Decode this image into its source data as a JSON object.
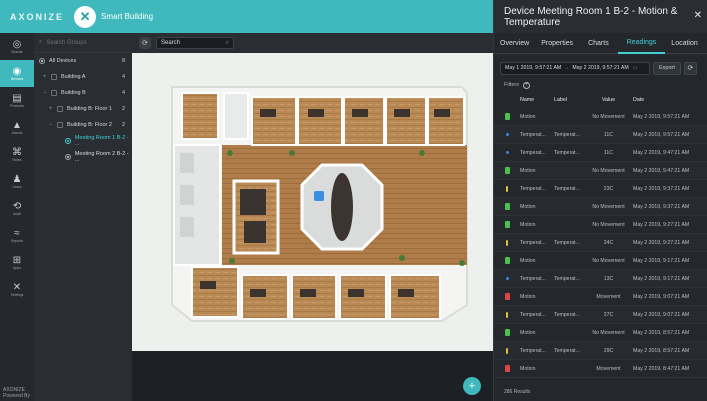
{
  "topbar": {
    "brand": "AXONIZE",
    "app_name": "Smart Building"
  },
  "nav": {
    "items": [
      {
        "label": "Boards",
        "icon": "boards-icon",
        "glyph": "◎"
      },
      {
        "label": "Devices",
        "icon": "devices-icon",
        "glyph": "◉"
      },
      {
        "label": "Products",
        "icon": "products-icon",
        "glyph": "▤"
      },
      {
        "label": "Alarms",
        "icon": "bell-icon",
        "glyph": "▲"
      },
      {
        "label": "Rules",
        "icon": "rules-icon",
        "glyph": "⌘"
      },
      {
        "label": "Users",
        "icon": "user-icon",
        "glyph": "♟"
      },
      {
        "label": "Audit",
        "icon": "history-icon",
        "glyph": "⟲"
      },
      {
        "label": "Reports",
        "icon": "reports-icon",
        "glyph": "≈"
      },
      {
        "label": "Apps",
        "icon": "apps-icon",
        "glyph": "⊞"
      },
      {
        "label": "Settings",
        "icon": "settings-icon",
        "glyph": "✕"
      }
    ],
    "footer_brand": "AXONIZE",
    "footer_powered": "Powered By"
  },
  "tree": {
    "search_placeholder": "Search Groups",
    "rows": [
      {
        "label": "All Devices",
        "count": "8"
      },
      {
        "label": "Building A",
        "count": "4"
      },
      {
        "label": "Building B",
        "count": "4"
      },
      {
        "label": "Building B: Floor 1",
        "count": "2"
      },
      {
        "label": "Building B: Floor 2",
        "count": "2"
      },
      {
        "label": "Meeting Room 1 B-2 - ..."
      },
      {
        "label": "Meeting Room 2 B-2 - ..."
      }
    ]
  },
  "mapbar": {
    "search_value": "Search"
  },
  "panel": {
    "title": "Device Meeting Room 1 B-2 - Motion & Temperature",
    "tabs": [
      "Overview",
      "Properties",
      "Charts",
      "Readings",
      "Location"
    ],
    "active_tab": "Readings",
    "date_from": "May 1 2019, 9:57:21 AM",
    "date_to": "May 2 2019, 9:57:21 AM",
    "export_label": "Export",
    "filters_label": "Filters",
    "columns": {
      "name": "Name",
      "label": "Label",
      "value": "Value",
      "date": "Date"
    },
    "rows": [
      {
        "kind": "motion-green",
        "name": "Motion",
        "label": "",
        "value": "No Movement",
        "date": "May 2 2019, 9:57:21 AM"
      },
      {
        "kind": "temp-blue",
        "name": "Temperat...",
        "label": "Temperat...",
        "value": "11C",
        "date": "May 2 2019, 9:57:21 AM"
      },
      {
        "kind": "temp-blue",
        "name": "Temperat...",
        "label": "Temperat...",
        "value": "11C",
        "date": "May 2 2019, 9:47:21 AM"
      },
      {
        "kind": "motion-green",
        "name": "Motion",
        "label": "",
        "value": "No Movement",
        "date": "May 2 2019, 9:47:21 AM"
      },
      {
        "kind": "temp-yellow",
        "name": "Temperat...",
        "label": "Temperat...",
        "value": "23C",
        "date": "May 2 2019, 9:37:21 AM"
      },
      {
        "kind": "motion-green",
        "name": "Motion",
        "label": "",
        "value": "No Movement",
        "date": "May 2 2019, 9:37:21 AM"
      },
      {
        "kind": "motion-green",
        "name": "Motion",
        "label": "",
        "value": "No Movement",
        "date": "May 2 2019, 9:27:21 AM"
      },
      {
        "kind": "temp-yellow",
        "name": "Temperat...",
        "label": "Temperat...",
        "value": "24C",
        "date": "May 2 2019, 9:27:21 AM"
      },
      {
        "kind": "motion-green",
        "name": "Motion",
        "label": "",
        "value": "No Movement",
        "date": "May 2 2019, 9:17:21 AM"
      },
      {
        "kind": "temp-blue",
        "name": "Temperat...",
        "label": "Temperat...",
        "value": "13C",
        "date": "May 2 2019, 9:17:21 AM"
      },
      {
        "kind": "motion-red",
        "name": "Motion",
        "label": "",
        "value": "Movement",
        "date": "May 2 2019, 9:07:21 AM"
      },
      {
        "kind": "temp-yellow",
        "name": "Temperat...",
        "label": "Temperat...",
        "value": "27C",
        "date": "May 2 2019, 9:07:21 AM"
      },
      {
        "kind": "motion-green",
        "name": "Motion",
        "label": "",
        "value": "No Movement",
        "date": "May 2 2019, 8:57:21 AM"
      },
      {
        "kind": "temp-yellow",
        "name": "Temperat...",
        "label": "Temperat...",
        "value": "29C",
        "date": "May 2 2019, 8:57:21 AM"
      },
      {
        "kind": "motion-red",
        "name": "Motion",
        "label": "",
        "value": "Movement",
        "date": "May 2 2019, 8:47:21 AM"
      }
    ],
    "results": "286 Results"
  },
  "colors": {
    "accent": "#3fb9bd",
    "motion_ok": "#4cc04f",
    "motion_alert": "#e04444",
    "temp_cold": "#3b87d9",
    "temp_warm": "#e1c23c"
  }
}
